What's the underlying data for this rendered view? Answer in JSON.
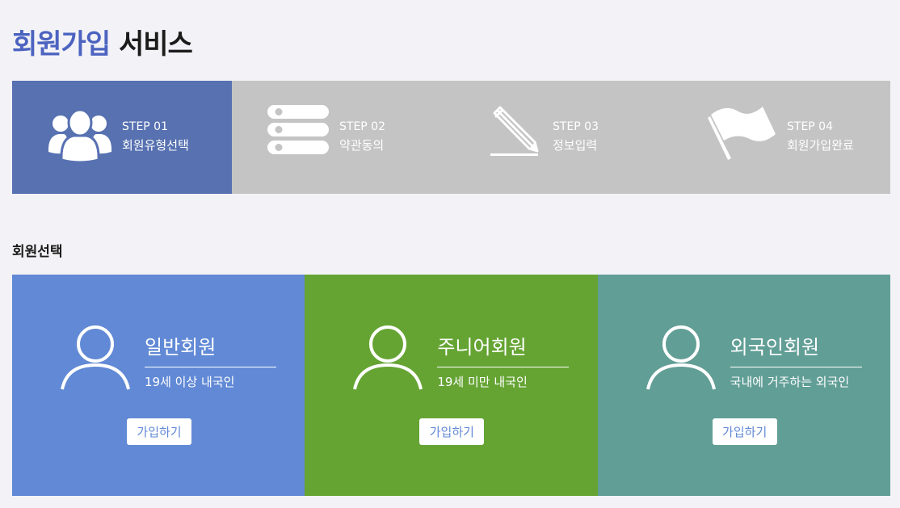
{
  "header": {
    "title_accent": "회원가입",
    "title_rest": "서비스"
  },
  "steps": [
    {
      "num": "STEP 01",
      "label": "회원유형선택",
      "icon": "users-icon",
      "active": true
    },
    {
      "num": "STEP 02",
      "label": "약관동의",
      "icon": "list-icon",
      "active": false
    },
    {
      "num": "STEP 03",
      "label": "정보입력",
      "icon": "pencil-icon",
      "active": false
    },
    {
      "num": "STEP 04",
      "label": "회원가입완료",
      "icon": "flag-icon",
      "active": false
    }
  ],
  "colors": {
    "accent": "#4c63c0",
    "step_active": "#5771b1",
    "step_inactive": "#c4c4c4",
    "card_general": "#6189d5",
    "card_junior": "#65a433",
    "card_foreign": "#619e96"
  },
  "section": {
    "title": "회원선택"
  },
  "cards": [
    {
      "name": "일반회원",
      "desc": "19세 이상 내국인",
      "button": "가입하기",
      "icon": "user-icon"
    },
    {
      "name": "주니어회원",
      "desc": "19세 미만 내국인",
      "button": "가입하기",
      "icon": "user-icon"
    },
    {
      "name": "외국인회원",
      "desc": "국내에 거주하는 외국인",
      "button": "가입하기",
      "icon": "user-icon"
    }
  ]
}
